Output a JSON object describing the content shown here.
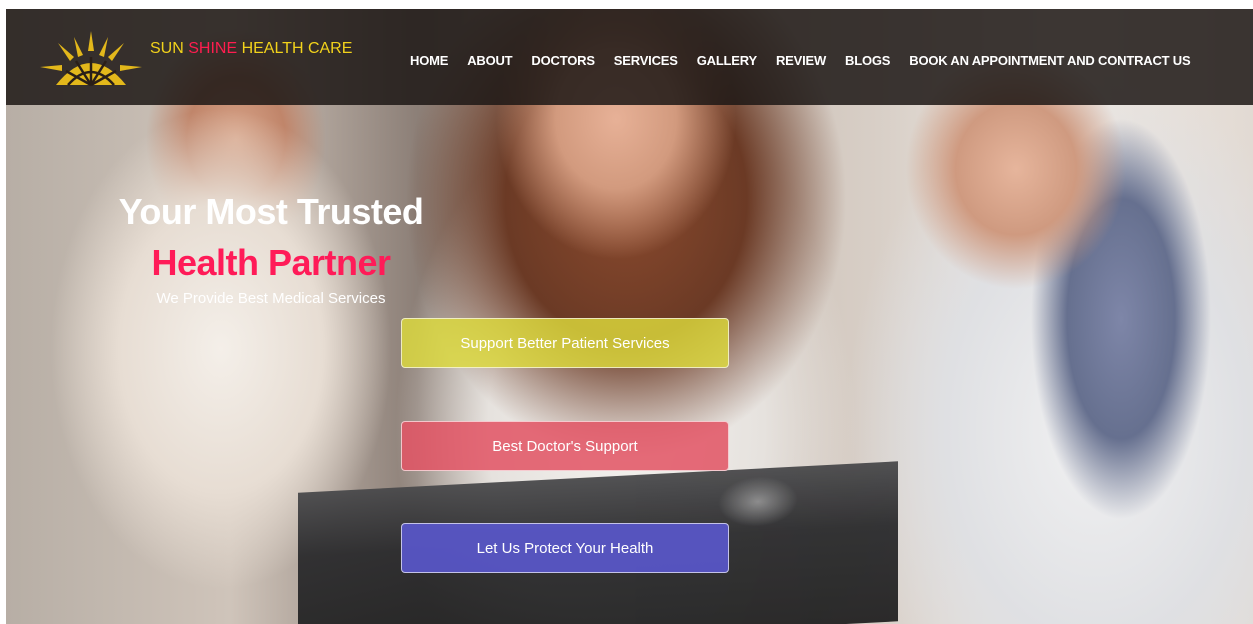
{
  "brand": {
    "part_sun": "SUN",
    "part_shine": " SHINE",
    "part_health": " HEALTH CARE",
    "colors": {
      "yellow": "#f2d21b",
      "pink": "#ff1d4f"
    }
  },
  "nav": {
    "items": [
      {
        "label": "HOME"
      },
      {
        "label": "ABOUT"
      },
      {
        "label": "DOCTORS"
      },
      {
        "label": "SERVICES"
      },
      {
        "label": "GALLERY"
      },
      {
        "label": "REVIEW"
      },
      {
        "label": "BLOGS"
      },
      {
        "label": "BOOK AN APPOINTMENT AND CONTRACT US"
      }
    ]
  },
  "hero": {
    "title_line1": "Your Most Trusted",
    "title_line2": "Health Partner",
    "subtitle": "We Provide Best Medical Services",
    "accent_color": "#ff1b58"
  },
  "cta": {
    "support_label": "Support Better Patient Services",
    "doctor_label": "Best Doctor's Support",
    "protect_label": "Let Us Protect Your Health",
    "colors": {
      "yellow": "#dddc3c",
      "red": "#e25464",
      "blue": "#5a58cd"
    }
  },
  "icons": {
    "logo": "sunrise-logo-icon"
  }
}
